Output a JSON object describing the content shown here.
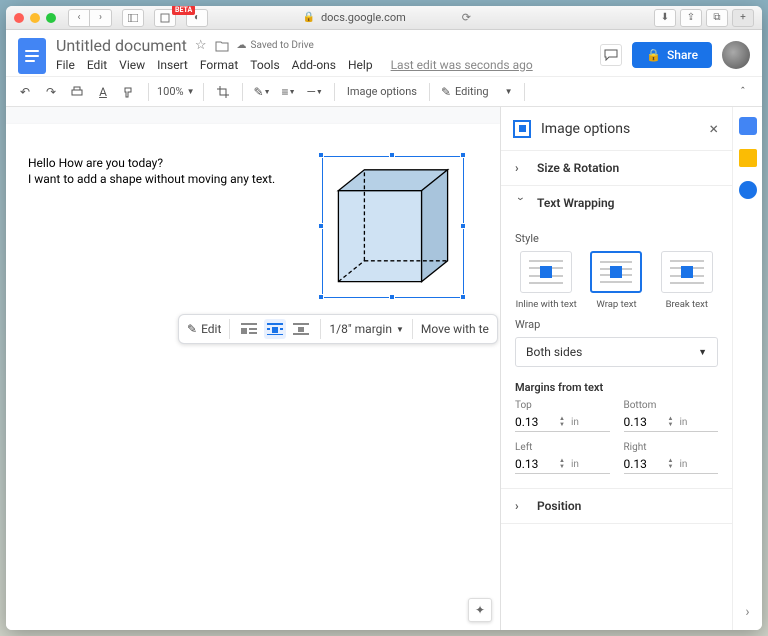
{
  "browser": {
    "url": "docs.google.com",
    "beta_badge": "BETA"
  },
  "header": {
    "title": "Untitled document",
    "saved_text": "Saved to Drive",
    "menus": [
      "File",
      "Edit",
      "View",
      "Insert",
      "Format",
      "Tools",
      "Add-ons",
      "Help"
    ],
    "last_edit": "Last edit was seconds ago",
    "share_label": "Share"
  },
  "toolbar": {
    "zoom": "100%",
    "image_options": "Image options",
    "editing": "Editing"
  },
  "document": {
    "line1": "Hello How are you today?",
    "line2": "I want to add a shape without moving any text."
  },
  "float_toolbar": {
    "edit": "Edit",
    "margin": "1/8\" margin",
    "move": "Move with te"
  },
  "panel": {
    "title": "Image options",
    "size_rotation": "Size & Rotation",
    "text_wrapping": "Text Wrapping",
    "style_label": "Style",
    "styles": {
      "inline": "Inline with text",
      "wrap": "Wrap text",
      "break": "Break text"
    },
    "wrap_label": "Wrap",
    "wrap_value": "Both sides",
    "margins_label": "Margins from text",
    "margins": {
      "top": {
        "label": "Top",
        "value": "0.13",
        "unit": "in"
      },
      "bottom": {
        "label": "Bottom",
        "value": "0.13",
        "unit": "in"
      },
      "left": {
        "label": "Left",
        "value": "0.13",
        "unit": "in"
      },
      "right": {
        "label": "Right",
        "value": "0.13",
        "unit": "in"
      }
    },
    "position": "Position"
  }
}
